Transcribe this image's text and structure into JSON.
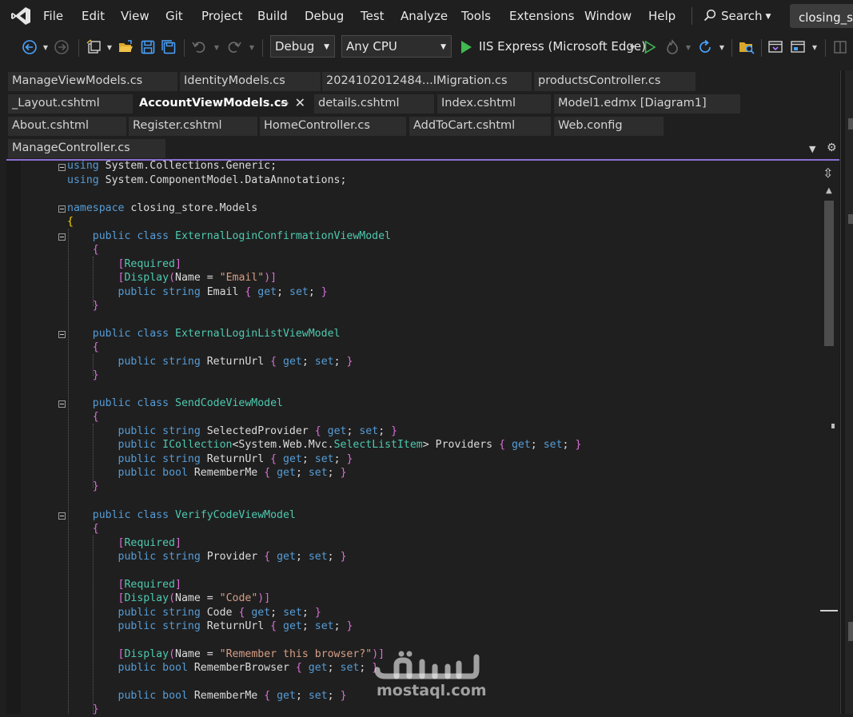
{
  "menu": {
    "items": [
      "File",
      "Edit",
      "View",
      "Git",
      "Project",
      "Build",
      "Debug",
      "Test",
      "Analyze",
      "Tools",
      "Extensions",
      "Window",
      "Help"
    ],
    "search_label": "Search",
    "solution_title": "closing_store"
  },
  "toolbar": {
    "configuration": "Debug",
    "platform": "Any CPU",
    "run_target": "IIS Express (Microsoft Edge)"
  },
  "tabs": {
    "row1": [
      "ManageViewModels.cs",
      "IdentityModels.cs",
      "2024102012484...IMigration.cs",
      "productsController.cs"
    ],
    "row2": [
      "_Layout.cshtml",
      "AccountViewModels.cs",
      "details.cshtml",
      "Index.cshtml",
      "Model1.edmx [Diagram1]"
    ],
    "row3": [
      "About.cshtml",
      "Register.cshtml",
      "HomeController.cs",
      "AddToCart.cshtml",
      "Web.config"
    ],
    "row4": [
      "ManageController.cs"
    ],
    "active": "AccountViewModels.cs"
  },
  "code": {
    "lines": [
      "using System.Collections.Generic;",
      "using System.ComponentModel.DataAnnotations;",
      "",
      "namespace closing_store.Models",
      "{",
      "    public class ExternalLoginConfirmationViewModel",
      "    {",
      "        [Required]",
      "        [Display(Name = \"Email\")]",
      "        public string Email { get; set; }",
      "    }",
      "",
      "    public class ExternalLoginListViewModel",
      "    {",
      "        public string ReturnUrl { get; set; }",
      "    }",
      "",
      "    public class SendCodeViewModel",
      "    {",
      "        public string SelectedProvider { get; set; }",
      "        public ICollection<System.Web.Mvc.SelectListItem> Providers { get; set; }",
      "        public string ReturnUrl { get; set; }",
      "        public bool RememberMe { get; set; }",
      "    }",
      "",
      "    public class VerifyCodeViewModel",
      "    {",
      "        [Required]",
      "        public string Provider { get; set; }",
      "",
      "        [Required]",
      "        [Display(Name = \"Code\")]",
      "        public string Code { get; set; }",
      "        public string ReturnUrl { get; set; }",
      "",
      "        [Display(Name = \"Remember this browser?\")]",
      "        public bool RememberBrowser { get; set; }",
      "",
      "        public bool RememberMe { get; set; }",
      "    }"
    ]
  },
  "watermark": {
    "arabic": "مستقل",
    "latin": "mostaql.com"
  },
  "colors": {
    "keyword": "#569cd6",
    "type": "#4ec9b0",
    "string": "#d69d85",
    "brace_outer": "#ffd700",
    "brace_inner": "#da70d6",
    "accent": "#8a6fd1",
    "run_green": "#3fb950"
  }
}
